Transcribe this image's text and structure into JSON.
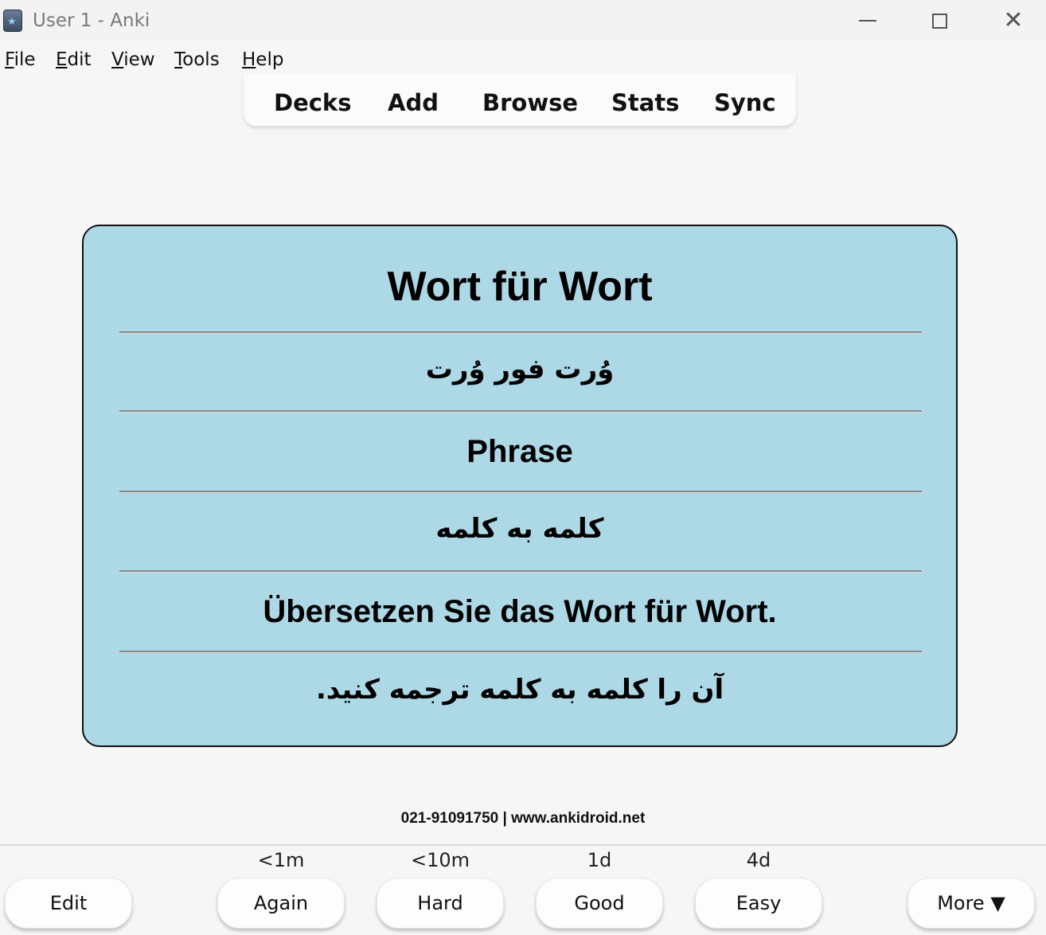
{
  "window": {
    "title": "User 1 - Anki",
    "controls": {
      "minimize": "minimize-icon",
      "maximize": "maximize-icon",
      "close": "close-icon"
    }
  },
  "menu": {
    "items": [
      {
        "label": "File",
        "key": "F",
        "rest": "ile"
      },
      {
        "label": "Edit",
        "key": "E",
        "rest": "dit"
      },
      {
        "label": "View",
        "key": "V",
        "rest": "iew"
      },
      {
        "label": "Tools",
        "key": "T",
        "rest": "ools"
      },
      {
        "label": "Help",
        "key": "H",
        "rest": "elp"
      }
    ]
  },
  "toolbar": {
    "decks": "Decks",
    "add": "Add",
    "browse": "Browse",
    "stats": "Stats",
    "sync": "Sync"
  },
  "card": {
    "background": "#add8e6",
    "word": "Wort für Wort",
    "word_pronunciation": "وُرت فور وُرت",
    "type": "Phrase",
    "word_translation": "کلمه به کلمه",
    "example": "Übersetzen Sie das Wort für Wort.",
    "example_translation": "آن را کلمه به کلمه ترجمه کنید."
  },
  "footer": {
    "text": "021-91091750 | www.ankidroid.net"
  },
  "answer_bar": {
    "edit": "Edit",
    "again": {
      "label": "Again",
      "interval": "<1m"
    },
    "hard": {
      "label": "Hard",
      "interval": "<10m"
    },
    "good": {
      "label": "Good",
      "interval": "1d"
    },
    "easy": {
      "label": "Easy",
      "interval": "4d"
    },
    "more": "More ▼"
  }
}
